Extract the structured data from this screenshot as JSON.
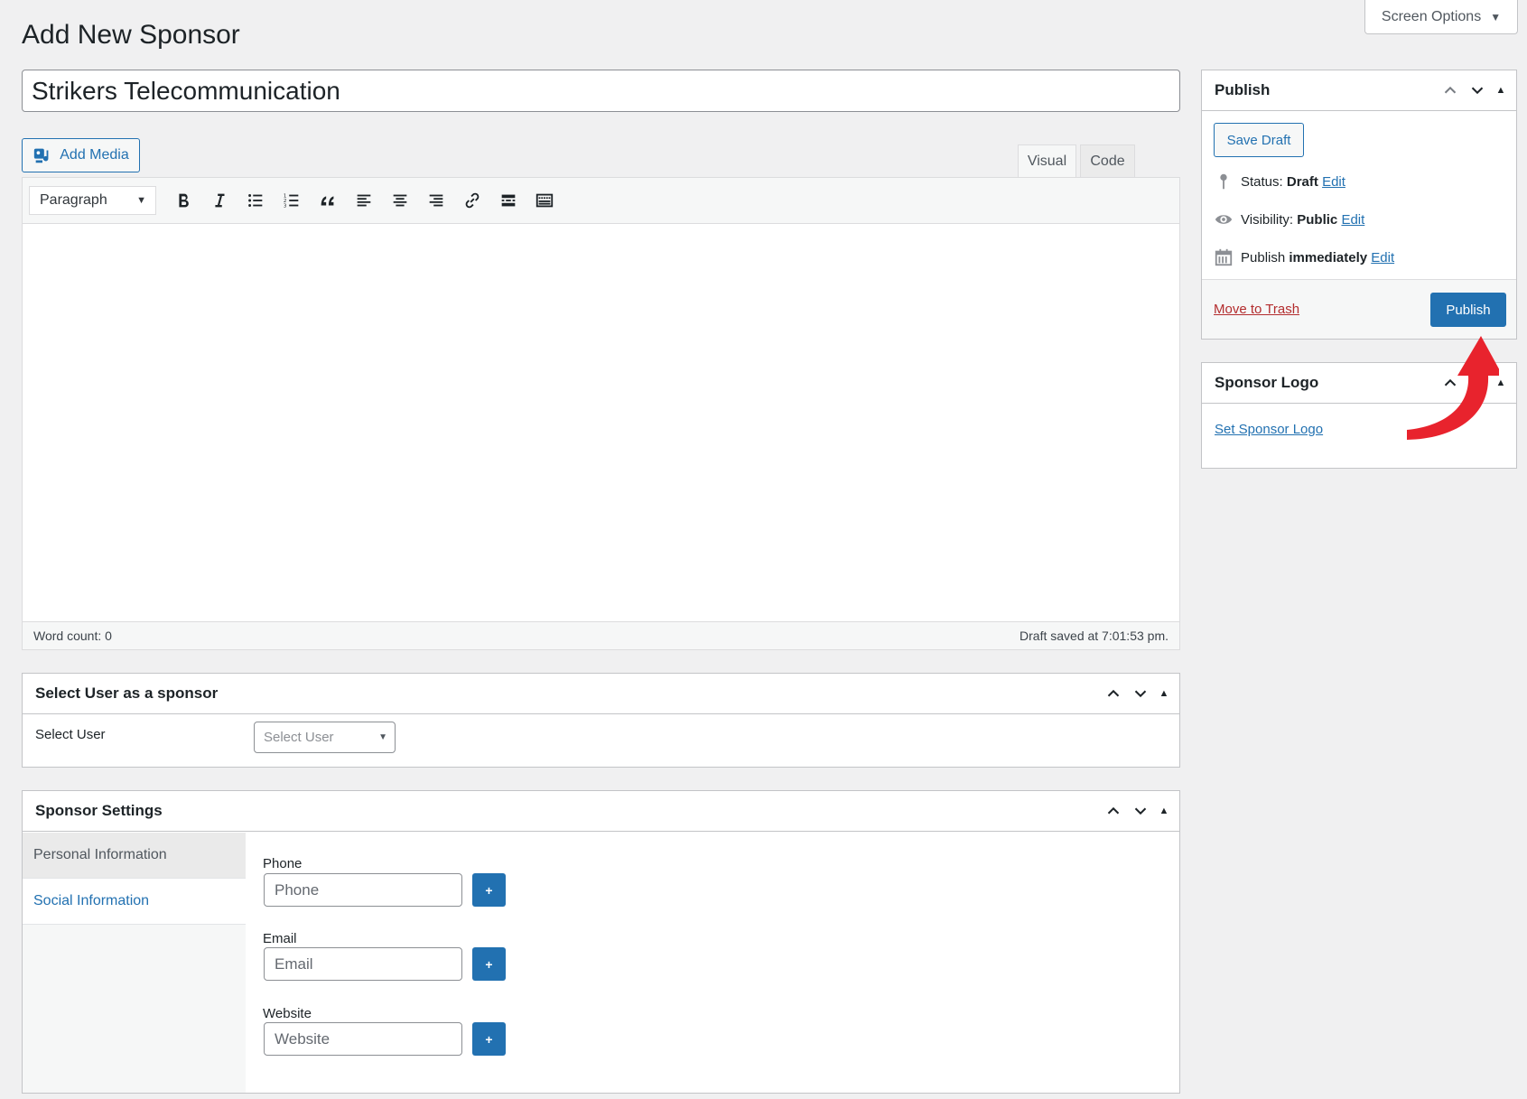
{
  "screen_options": {
    "label": "Screen Options"
  },
  "page": {
    "title": "Add New Sponsor"
  },
  "post_title": {
    "value": "Strikers Telecommunication"
  },
  "media": {
    "add_media_label": "Add Media"
  },
  "editor": {
    "tabs": [
      "Visual",
      "Code"
    ],
    "format_select": "Paragraph",
    "toolbar_icons": [
      "bold-icon",
      "italic-icon",
      "bullet-list-icon",
      "numbered-list-icon",
      "blockquote-icon",
      "align-left-icon",
      "align-center-icon",
      "align-right-icon",
      "link-icon",
      "read-more-icon",
      "toolbar-toggle-icon"
    ],
    "word_count": "Word count: 0",
    "draft_saved": "Draft saved at 7:01:53 pm."
  },
  "select_user_box": {
    "title": "Select User as a sponsor",
    "label": "Select User",
    "placeholder": "Select User"
  },
  "sponsor_settings": {
    "title": "Sponsor Settings",
    "nav": [
      "Personal Information",
      "Social Information"
    ],
    "fields": [
      {
        "label": "Phone",
        "placeholder": "Phone",
        "button": "+"
      },
      {
        "label": "Email",
        "placeholder": "Email",
        "button": "+"
      },
      {
        "label": "Website",
        "placeholder": "Website",
        "button": "+"
      }
    ]
  },
  "publish_box": {
    "title": "Publish",
    "save_draft": "Save Draft",
    "status_label": "Status:",
    "status_value": "Draft",
    "visibility_label": "Visibility:",
    "visibility_value": "Public",
    "publish_label": "Publish",
    "publish_value": "immediately",
    "edit": "Edit",
    "trash": "Move to Trash",
    "publish_button": "Publish"
  },
  "logo_box": {
    "title": "Sponsor Logo",
    "set_logo": "Set Sponsor Logo"
  },
  "colors": {
    "accent": "#2271b1",
    "trash": "#b32d2e",
    "annotation_arrow": "#e8232d"
  }
}
